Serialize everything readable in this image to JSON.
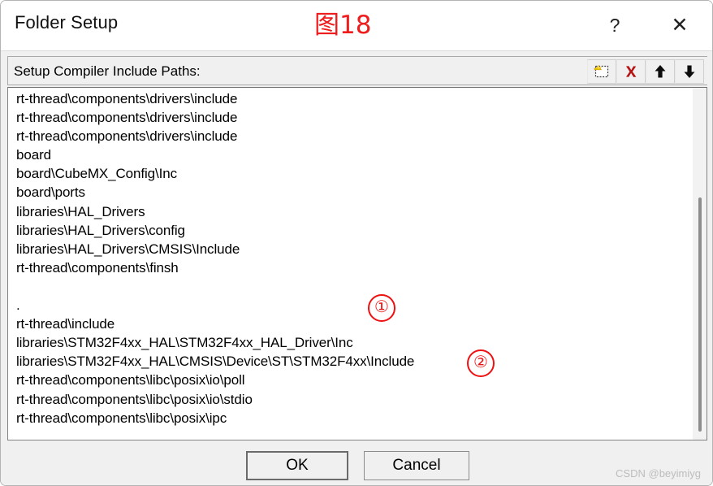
{
  "window": {
    "title": "Folder Setup",
    "help_label": "?",
    "close_label": "✕",
    "annotation": "图18"
  },
  "group": {
    "header_label": "Setup Compiler Include Paths:"
  },
  "toolbar": {
    "buttons": [
      {
        "name": "new-path-button",
        "icon": "new-folder-icon",
        "tooltip": "New (Insert)"
      },
      {
        "name": "delete-path-button",
        "icon": "red-x-icon",
        "tooltip": "Delete (Delete)"
      },
      {
        "name": "move-up-button",
        "icon": "arrow-up-icon",
        "tooltip": "Move Up"
      },
      {
        "name": "move-down-button",
        "icon": "arrow-down-icon",
        "tooltip": "Move Down"
      }
    ]
  },
  "include_paths": [
    "rt-thread\\components\\drivers\\include",
    "rt-thread\\components\\drivers\\include",
    "rt-thread\\components\\drivers\\include",
    "board",
    "board\\CubeMX_Config\\Inc",
    "board\\ports",
    "libraries\\HAL_Drivers",
    "libraries\\HAL_Drivers\\config",
    "libraries\\HAL_Drivers\\CMSIS\\Include",
    "rt-thread\\components\\finsh",
    "",
    ".",
    "rt-thread\\include",
    "libraries\\STM32F4xx_HAL\\STM32F4xx_HAL_Driver\\Inc",
    "libraries\\STM32F4xx_HAL\\CMSIS\\Device\\ST\\STM32F4xx\\Include",
    "rt-thread\\components\\libc\\posix\\io\\poll",
    "rt-thread\\components\\libc\\posix\\io\\stdio",
    "rt-thread\\components\\libc\\posix\\ipc"
  ],
  "annotations": {
    "marker_1": "①",
    "marker_2": "②"
  },
  "buttons": {
    "ok_label": "OK",
    "cancel_label": "Cancel"
  },
  "watermark": "CSDN @beyimiyg",
  "colors": {
    "annotation_red": "#ee1c1c",
    "dialog_background": "#f0f0f0",
    "list_background": "#ffffff",
    "delete_icon_red": "#b51414",
    "new_icon_yellow": "#ffd400"
  }
}
